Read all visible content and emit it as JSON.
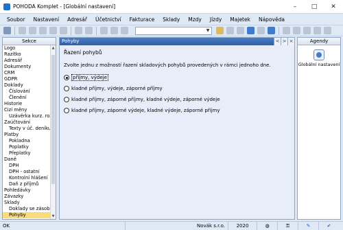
{
  "window": {
    "title": "POHODA Komplet - [Globální nastavení]"
  },
  "menu": [
    "Soubor",
    "Nastavení",
    "Adresář",
    "Účetnictví",
    "Fakturace",
    "Sklady",
    "Mzdy",
    "Jízdy",
    "Majetek",
    "Nápověda"
  ],
  "sidebar": {
    "header": "Sekce",
    "items": [
      {
        "label": "Logo",
        "level": 0
      },
      {
        "label": "Razítko",
        "level": 0
      },
      {
        "label": "Adresář",
        "level": 0
      },
      {
        "label": "Dokumenty",
        "level": 0
      },
      {
        "label": "CRM",
        "level": 0
      },
      {
        "label": "GDPR",
        "level": 0
      },
      {
        "label": "Doklady",
        "level": 0
      },
      {
        "label": "Číslování",
        "level": 1
      },
      {
        "label": "Členění",
        "level": 1
      },
      {
        "label": "Historie",
        "level": 0
      },
      {
        "label": "Cizí měny",
        "level": 0
      },
      {
        "label": "Uzávěrka kurz. rozdílů",
        "level": 1
      },
      {
        "label": "Zaúčtování",
        "level": 0
      },
      {
        "label": "Texty v úč. deníku",
        "level": 1
      },
      {
        "label": "Platby",
        "level": 0
      },
      {
        "label": "Pokladna",
        "level": 1
      },
      {
        "label": "Poplatky",
        "level": 1
      },
      {
        "label": "Přeplatky",
        "level": 1
      },
      {
        "label": "Daně",
        "level": 0
      },
      {
        "label": "DPH",
        "level": 1
      },
      {
        "label": "DPH - ostatní",
        "level": 1
      },
      {
        "label": "Kontrolní hlášení",
        "level": 1
      },
      {
        "label": "Daň z příjmů",
        "level": 1
      },
      {
        "label": "Pohledávky",
        "level": 0
      },
      {
        "label": "Závazky",
        "level": 0
      },
      {
        "label": "Sklady",
        "level": 0
      },
      {
        "label": "Doklady se zásobami",
        "level": 1
      },
      {
        "label": "Pohyby",
        "level": 1,
        "active": true
      }
    ]
  },
  "main": {
    "header": "Pohyby",
    "nav": [
      "<",
      ">",
      "×"
    ],
    "section_title": "Řazení pohybů",
    "instruction": "Zvolte jednu z možností řazení skladových pohybů provedených v rámci jednoho dne.",
    "options": [
      {
        "label": "příjmy, výdeje",
        "selected": true
      },
      {
        "label": "kladné příjmy, výdeje, záporné příjmy",
        "selected": false
      },
      {
        "label": "kladné příjmy, záporné příjmy, kladné výdeje, záporné výdeje",
        "selected": false
      },
      {
        "label": "kladné příjmy, záporné výdeje, kladné výdeje, záporné příjmy",
        "selected": false
      }
    ]
  },
  "agendy": {
    "header": "Agendy",
    "items": [
      {
        "label": "Globální nastavení",
        "icon": "settings-icon"
      }
    ]
  },
  "status": {
    "left": "OK",
    "company": "Novák s.r.o.",
    "year": "2020"
  }
}
